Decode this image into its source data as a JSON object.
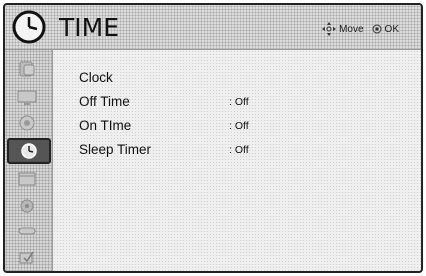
{
  "header": {
    "title": "TIME",
    "hint_move": "Move",
    "hint_ok": "OK"
  },
  "sidebar": {
    "items": [
      {
        "icon": "picture-icon"
      },
      {
        "icon": "screen-icon"
      },
      {
        "icon": "audio-icon"
      },
      {
        "icon": "clock-icon"
      },
      {
        "icon": "calendar-icon"
      },
      {
        "icon": "lock-icon"
      },
      {
        "icon": "input-icon"
      },
      {
        "icon": "usb-icon"
      }
    ],
    "active_index": 3
  },
  "menu": {
    "items": [
      {
        "label": "Clock",
        "value": ""
      },
      {
        "label": "Off Time",
        "value": ": Off"
      },
      {
        "label": "On TIme",
        "value": ": Off"
      },
      {
        "label": "Sleep Timer",
        "value": ": Off"
      }
    ]
  },
  "colors": {
    "header_bg": "#dcdcdc",
    "sidebar_bg": "#d6d6d6",
    "active_bg": "#555555",
    "text": "#111111"
  }
}
